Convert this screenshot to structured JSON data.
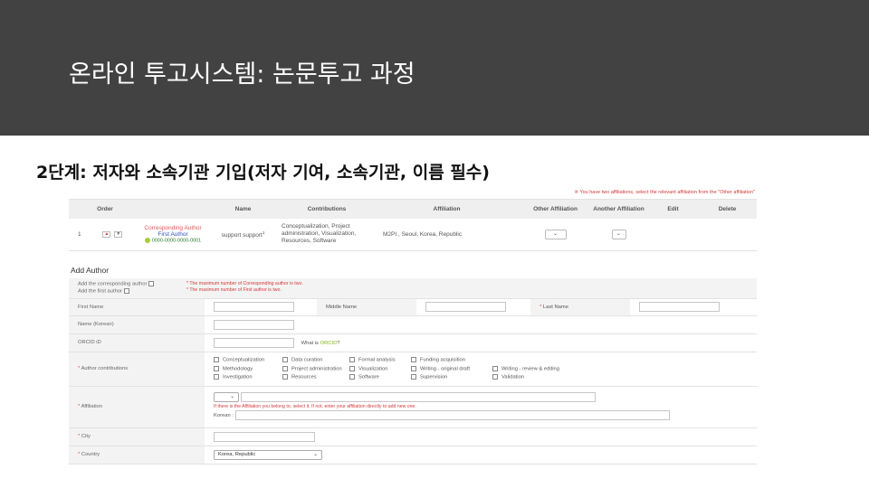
{
  "header": {
    "title": "온라인 투고시스템: 논문투고 과정"
  },
  "subtitle": "2단계: 저자와 소속기관 기입(저자 기여, 소속기관, 이름 필수)",
  "top_note": "※ You have two affiliations, select the relevant affiliation from the \"Other affiliation\"",
  "author_table": {
    "headers": [
      "Order",
      "Name",
      "Contributions",
      "Affiliation",
      "Other Affiliation",
      "Another Affiliation",
      "Edit",
      "Delete"
    ],
    "row": {
      "order": "1",
      "up": "▲",
      "down": "▼",
      "role_corr": "Corresponding Author",
      "role_first": "First Author",
      "orcid": "0000-0000-0000-0001",
      "name": "support support",
      "name_sup": "1",
      "contributions": "Conceptualization, Project administration, Visualization, Resources, Software",
      "affiliation": "M2PI , Seoul, Korea, Republic",
      "select_caret": "⌄"
    }
  },
  "add_author": {
    "title": "Add Author",
    "corr_label": "Add the corresponding author",
    "first_label": "Add the first author",
    "corr_note": "* The maximum number of Corresponding author is two.",
    "first_note": "* The maximum number of First author is two.",
    "first_name": "First Name",
    "middle_name": "Middle Name",
    "last_name_star": "*",
    "last_name": "Last Name",
    "name_korean": "Name (Korean)",
    "orcid_label": "ORCID iD",
    "orcid_what": "What is",
    "orcid_link": "ORCID",
    "orcid_q": "?",
    "contrib_label": "Author contributions",
    "contributions": [
      "Conceptualization",
      "Data curation",
      "Formal analysis",
      "Funding acquisition",
      "",
      "Methodology",
      "Project administration",
      "Visualization",
      "Writing - original draft",
      "Writing - review & editing",
      "Investigation",
      "Resources",
      "Software",
      "Supervision",
      "Validation"
    ],
    "affiliation_label": "Affiliation",
    "affiliation_note": "If there is the Affiliation you belong to, select it. If not, enter your affiliation directly to add new one.",
    "korean_label": "Korean :",
    "city_label": "City",
    "country_label": "Country",
    "country_value": "Korea, Republic",
    "req_star": "*"
  }
}
